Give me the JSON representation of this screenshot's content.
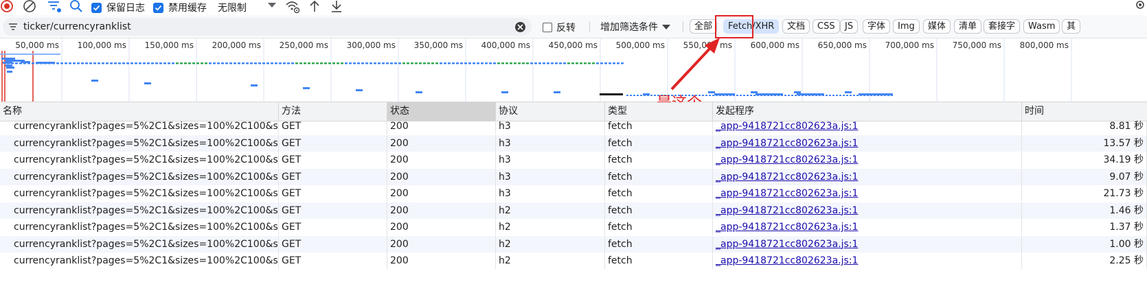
{
  "toolbar": {
    "preserve_log_label": "保留日志",
    "preserve_log_checked": true,
    "disable_cache_label": "禁用缓存",
    "disable_cache_checked": true,
    "throttle_value": "无限制",
    "icons": [
      "record-stop-icon",
      "clear-icon",
      "filter-toggle-icon",
      "search-icon",
      "wifi-settings-icon",
      "upload-icon",
      "download-icon",
      "settings-icon"
    ]
  },
  "filter": {
    "value": "ticker/currencyranklist",
    "invert_label": "反转",
    "invert_checked": false,
    "more_filters_label": "增加筛选条件",
    "types": [
      {
        "label": "全部",
        "selected": false
      },
      {
        "label": "Fetch/XHR",
        "selected": true
      },
      {
        "label": "文档",
        "selected": false
      },
      {
        "label": "CSS",
        "selected": false
      },
      {
        "label": "JS",
        "selected": false
      },
      {
        "label": "字体",
        "selected": false
      },
      {
        "label": "Img",
        "selected": false
      },
      {
        "label": "媒体",
        "selected": false
      },
      {
        "label": "清单",
        "selected": false
      },
      {
        "label": "套接字",
        "selected": false
      },
      {
        "label": "Wasm",
        "selected": false
      },
      {
        "label": "其",
        "selected": false
      }
    ]
  },
  "timeline": {
    "ticks": [
      "50,000 ms",
      "100,000 ms",
      "150,000 ms",
      "200,000 ms",
      "250,000 ms",
      "300,000 ms",
      "350,000 ms",
      "400,000 ms",
      "450,000 ms",
      "500,000 ms",
      "550,000 ms",
      "600,000 ms",
      "650,000 ms",
      "700,000 ms",
      "750,000 ms",
      "800,000 ms"
    ]
  },
  "annotation": {
    "text": "是这个",
    "color": "#e02424"
  },
  "table": {
    "columns": [
      "名称",
      "方法",
      "状态",
      "协议",
      "类型",
      "发起程序",
      "时间"
    ],
    "sorted_column": "状态",
    "rows": [
      {
        "name": "currencyranklist?pages=5%2C1&sizes=100%2C100&s...",
        "method": "GET",
        "status": "200",
        "protocol": "h3",
        "type": "fetch",
        "initiator": "_app-9418721cc802623a.js:1",
        "time": "8.81 秒"
      },
      {
        "name": "currencyranklist?pages=5%2C1&sizes=100%2C100&s...",
        "method": "GET",
        "status": "200",
        "protocol": "h3",
        "type": "fetch",
        "initiator": "_app-9418721cc802623a.js:1",
        "time": "13.57 秒"
      },
      {
        "name": "currencyranklist?pages=5%2C1&sizes=100%2C100&s...",
        "method": "GET",
        "status": "200",
        "protocol": "h3",
        "type": "fetch",
        "initiator": "_app-9418721cc802623a.js:1",
        "time": "34.19 秒"
      },
      {
        "name": "currencyranklist?pages=5%2C1&sizes=100%2C100&s...",
        "method": "GET",
        "status": "200",
        "protocol": "h3",
        "type": "fetch",
        "initiator": "_app-9418721cc802623a.js:1",
        "time": "9.07 秒"
      },
      {
        "name": "currencyranklist?pages=5%2C1&sizes=100%2C100&s...",
        "method": "GET",
        "status": "200",
        "protocol": "h3",
        "type": "fetch",
        "initiator": "_app-9418721cc802623a.js:1",
        "time": "21.73 秒"
      },
      {
        "name": "currencyranklist?pages=5%2C1&sizes=100%2C100&s...",
        "method": "GET",
        "status": "200",
        "protocol": "h2",
        "type": "fetch",
        "initiator": "_app-9418721cc802623a.js:1",
        "time": "1.46 秒"
      },
      {
        "name": "currencyranklist?pages=5%2C1&sizes=100%2C100&s...",
        "method": "GET",
        "status": "200",
        "protocol": "h2",
        "type": "fetch",
        "initiator": "_app-9418721cc802623a.js:1",
        "time": "1.37 秒"
      },
      {
        "name": "currencyranklist?pages=5%2C1&sizes=100%2C100&s...",
        "method": "GET",
        "status": "200",
        "protocol": "h2",
        "type": "fetch",
        "initiator": "_app-9418721cc802623a.js:1",
        "time": "1.00 秒"
      },
      {
        "name": "currencyranklist?pages=5%2C1&sizes=100%2C100&s...",
        "method": "GET",
        "status": "200",
        "protocol": "h2",
        "type": "fetch",
        "initiator": "_app-9418721cc802623a.js:1",
        "time": "2.25 秒"
      }
    ]
  }
}
